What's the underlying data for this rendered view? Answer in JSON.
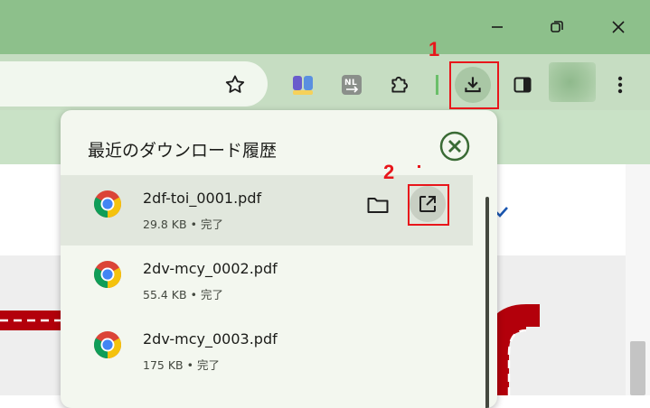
{
  "window": {
    "buttons": [
      "minimize",
      "restore",
      "close"
    ]
  },
  "toolbar": {
    "icons": [
      "bookmark-star-icon",
      "extension-1-icon",
      "extension-2-icon",
      "extensions-puzzle-icon",
      "downloads-icon",
      "side-panel-icon",
      "profile-avatar",
      "menu-kebab-icon"
    ]
  },
  "downloads_popup": {
    "title": "最近のダウンロード履歴",
    "close_icon": "close-circle-icon",
    "items": [
      {
        "filename": "2df-toi_0001.pdf",
        "size": "29.8 KB",
        "bullet": "•",
        "status": "完了",
        "selected": true
      },
      {
        "filename": "2dv-mcy_0002.pdf",
        "size": "55.4 KB",
        "bullet": "•",
        "status": "完了",
        "selected": false
      },
      {
        "filename": "2dv-mcy_0003.pdf",
        "size": "175 KB",
        "bullet": "•",
        "status": "完了",
        "selected": false
      }
    ],
    "item_actions": [
      "show-in-folder-icon",
      "open-file-icon"
    ]
  },
  "annotations": [
    {
      "label": "1",
      "target": "downloads-button"
    },
    {
      "label": "2",
      "target": "open-file-button"
    }
  ],
  "colors": {
    "titlebar": "#8dc08b",
    "toolbar": "#c6ddc2",
    "popup_bg": "#f3f7ef",
    "selected_row": "#e1e7dd",
    "annotation_red": "#e8161b",
    "close_green": "#3a6b35"
  }
}
